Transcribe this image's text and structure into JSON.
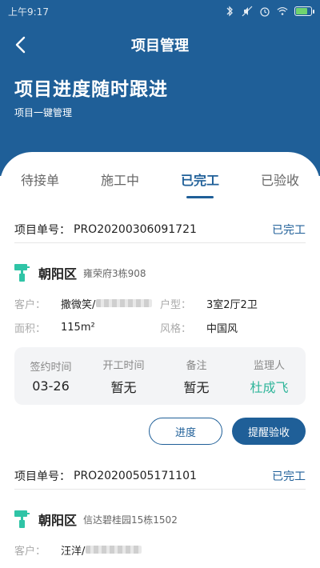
{
  "status_bar": {
    "time": "上午9:17"
  },
  "nav": {
    "title": "项目管理"
  },
  "hero": {
    "title": "项目进度随时跟进",
    "subtitle": "项目一键管理"
  },
  "colors": {
    "primary": "#1f5f98",
    "accent_green": "#2fb59a"
  },
  "tabs": [
    {
      "label": "待接单",
      "active": false
    },
    {
      "label": "施工中",
      "active": false
    },
    {
      "label": "已完工",
      "active": true
    },
    {
      "label": "已验收",
      "active": false
    }
  ],
  "orders": [
    {
      "order_label": "项目单号：",
      "order_no": "PRO20200306091721",
      "status": "已完工",
      "district": "朝阳区",
      "address": "雍荣府3栋908",
      "fields": {
        "customer_label": "客户：",
        "customer_value": "撒微笑/",
        "type_label": "户型：",
        "type_value": "3室2厅2卫",
        "area_label": "面积：",
        "area_value": "115m²",
        "style_label": "风格：",
        "style_value": "中国风"
      },
      "summary": [
        {
          "label": "签约时间",
          "value": "03-26"
        },
        {
          "label": "开工时间",
          "value": "暂无"
        },
        {
          "label": "备注",
          "value": "暂无"
        },
        {
          "label": "监理人",
          "value": "杜成飞"
        }
      ],
      "actions": {
        "progress": "进度",
        "remind": "提醒验收"
      }
    },
    {
      "order_label": "项目单号：",
      "order_no": "PRO20200505171101",
      "status": "已完工",
      "district": "朝阳区",
      "address": "信达碧桂园15栋1502",
      "fields": {
        "customer_label": "客户：",
        "customer_value": "汪洋/"
      }
    }
  ]
}
